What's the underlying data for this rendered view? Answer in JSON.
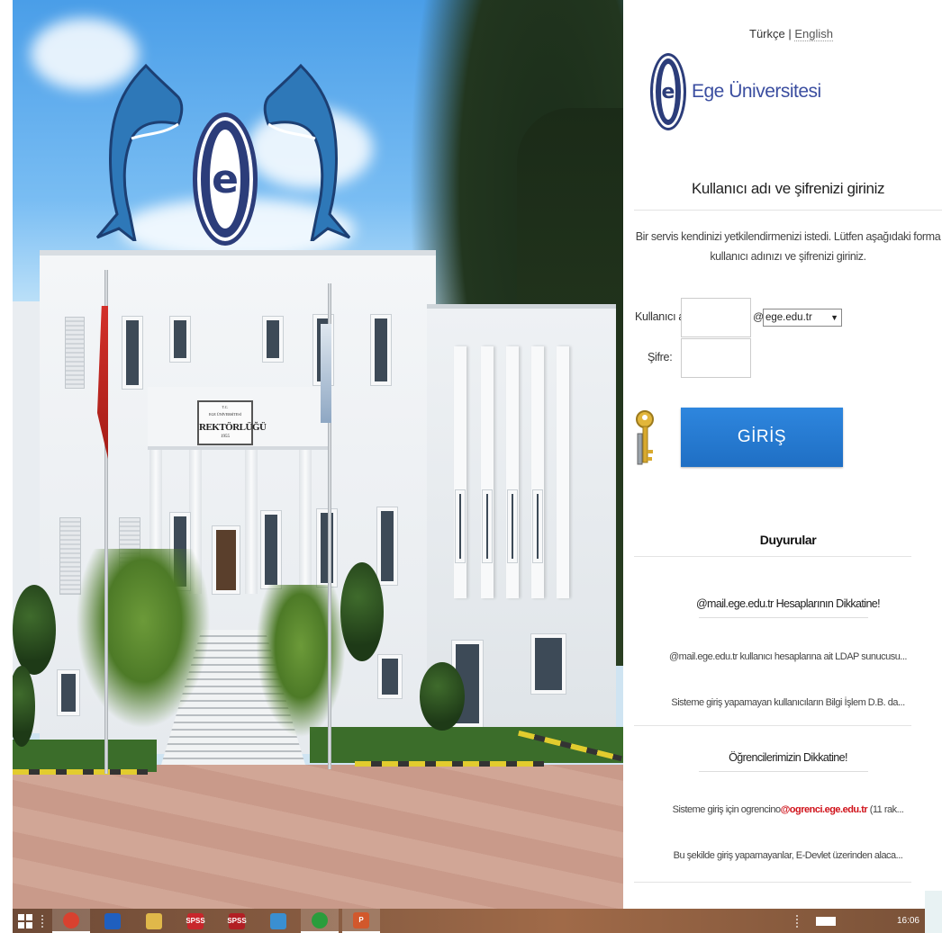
{
  "language": {
    "turkish": "Türkçe",
    "separator": "|",
    "english": "English"
  },
  "brand": {
    "name": "Ege Üniversitesi",
    "logo_letter": "e"
  },
  "photo": {
    "plaque_line1": "T.C.",
    "plaque_line2": "EGE ÜNİVERSİTESİ",
    "plaque_line3": "REKTÖRLÜĞÜ",
    "plaque_line4": "1955"
  },
  "login": {
    "title": "Kullanıcı adı ve şifrenizi giriniz",
    "description": "Bir servis kendinizi yetkilendirmenizi istedi. Lütfen aşağıdaki forma kullanıcı adınızı ve şifrenizi giriniz.",
    "username_label": "Kullanıcı adı:",
    "username_value": "",
    "at_sign": "@",
    "domain_selected": "ege.edu.tr",
    "domain_arrow": "▼",
    "password_label": "Şifre:",
    "password_value": "",
    "submit_label": "GİRİŞ"
  },
  "announcements": {
    "title": "Duyurular",
    "groups": [
      {
        "heading": "@mail.ege.edu.tr Hesaplarının Dikkatine!",
        "items": [
          "@mail.ege.edu.tr kullanıcı hesaplarına ait LDAP sunucusu...",
          "Sisteme giriş yapamayan kullanıcıların Bilgi İşlem D.B. da..."
        ]
      },
      {
        "heading": "Öğrencilerimizin Dikkatine!",
        "items": [
          {
            "prefix": "Sisteme giriş için ogrencino",
            "highlight": "@ogrenci.ege.edu.tr",
            "suffix": " (11 rak..."
          },
          "Bu şekilde giriş yapamayanlar, E-Devlet üzerinden alaca..."
        ]
      }
    ]
  },
  "taskbar": {
    "start_icon": "windows-icon",
    "apps": [
      {
        "name": "chrome-icon",
        "label": "",
        "color": "#d8412f"
      },
      {
        "name": "app-blue-icon",
        "label": "",
        "color": "#1f5fbf"
      },
      {
        "name": "folder-icon",
        "label": "",
        "color": "#e0b84a"
      },
      {
        "name": "spss-icon",
        "label": "SPSS",
        "color": "#c8262b"
      },
      {
        "name": "spss2-icon",
        "label": "SPSS",
        "color": "#b21f24"
      },
      {
        "name": "app-lightblue-icon",
        "label": "",
        "color": "#3a8fd1"
      },
      {
        "name": "media-icon",
        "label": "",
        "color": "#2a9d3c"
      },
      {
        "name": "powerpoint-icon",
        "label": "P",
        "color": "#d2582c"
      }
    ],
    "clock": "16:06"
  }
}
